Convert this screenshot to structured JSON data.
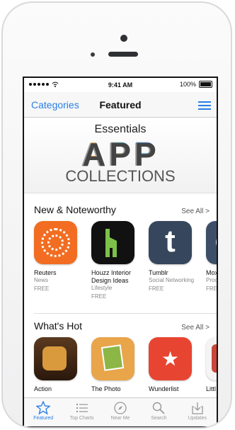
{
  "status": {
    "time": "9:41 AM",
    "battery": "100%"
  },
  "nav": {
    "categories": "Categories",
    "title": "Featured"
  },
  "banner": {
    "kicker": "Essentials",
    "headline": "APP",
    "subheadline": "COLLECTIONS"
  },
  "new_noteworthy": {
    "title": "New & Noteworthy",
    "see_all": "See All >",
    "apps": [
      {
        "name": "Reuters",
        "category": "News",
        "price": "FREE"
      },
      {
        "name": "Houzz Interior Design Ideas",
        "category": "Lifestyle",
        "price": "FREE"
      },
      {
        "name": "Tumblr",
        "category": "Social Networking",
        "price": "FREE"
      },
      {
        "name": "Mox Bind",
        "category": "Prod",
        "price": "FREE"
      }
    ]
  },
  "whats_hot": {
    "title": "What's Hot",
    "see_all": "See All >",
    "apps": [
      {
        "name": "Action"
      },
      {
        "name": "The Photo"
      },
      {
        "name": "Wunderlist"
      },
      {
        "name": "Littl"
      }
    ]
  },
  "tabs": [
    {
      "label": "Featured",
      "icon": "star-icon",
      "active": true
    },
    {
      "label": "Top Charts",
      "icon": "list-icon",
      "active": false
    },
    {
      "label": "Near Me",
      "icon": "compass-icon",
      "active": false
    },
    {
      "label": "Search",
      "icon": "search-icon",
      "active": false
    },
    {
      "label": "Updates",
      "icon": "download-icon",
      "active": false
    }
  ],
  "colors": {
    "accent": "#2a7fe4",
    "reuters": "#f26d22",
    "tumblr": "#36465d",
    "wunderlist": "#e74532"
  }
}
